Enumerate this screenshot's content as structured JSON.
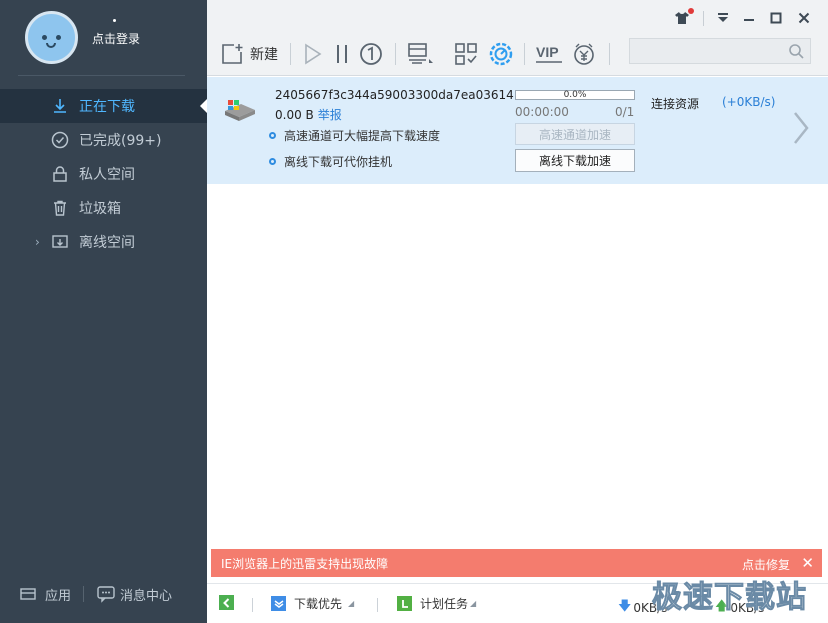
{
  "user": {
    "login_label": "点击登录"
  },
  "nav": {
    "items": [
      {
        "label": "正在下载",
        "icon": "download-icon",
        "active": true
      },
      {
        "label": "已完成(99+)",
        "icon": "check-circle-icon"
      },
      {
        "label": "私人空间",
        "icon": "lock-icon"
      },
      {
        "label": "垃圾箱",
        "icon": "trash-icon"
      },
      {
        "label": "离线空间",
        "icon": "cloud-download-icon"
      }
    ]
  },
  "sidebar_bottom": {
    "apps_label": "应用",
    "messages_label": "消息中心"
  },
  "toolbar": {
    "new_label": "新建"
  },
  "task": {
    "filename": "2405667f3c344a59003300da7ea03614",
    "size": "0.00 B",
    "report_label": "举报",
    "progress": {
      "percent_text": "0.0%",
      "value": 0.0
    },
    "time": "00:00:00",
    "parts": "0/1",
    "hint_highspeed": "高速通道可大幅提高下载速度",
    "hint_offline": "离线下载可代你挂机",
    "btn_highspeed": "高速通道加速",
    "btn_offline": "离线下载加速",
    "status": "连接资源",
    "speed": "(+0KB/s)"
  },
  "alert": {
    "message": "IE浏览器上的迅雷支持出现故障",
    "fix_label": "点击修复"
  },
  "statusbar": {
    "download_priority": "下载优先",
    "scheduled_task": "计划任务",
    "down_speed": "0KB/s",
    "up_speed": "0KB/s"
  },
  "watermark": "极速下载站",
  "colors": {
    "sidebar": "#364350",
    "accent": "#4fb7ff",
    "task_bg": "#dcedfb",
    "alert": "#f47c6e"
  }
}
